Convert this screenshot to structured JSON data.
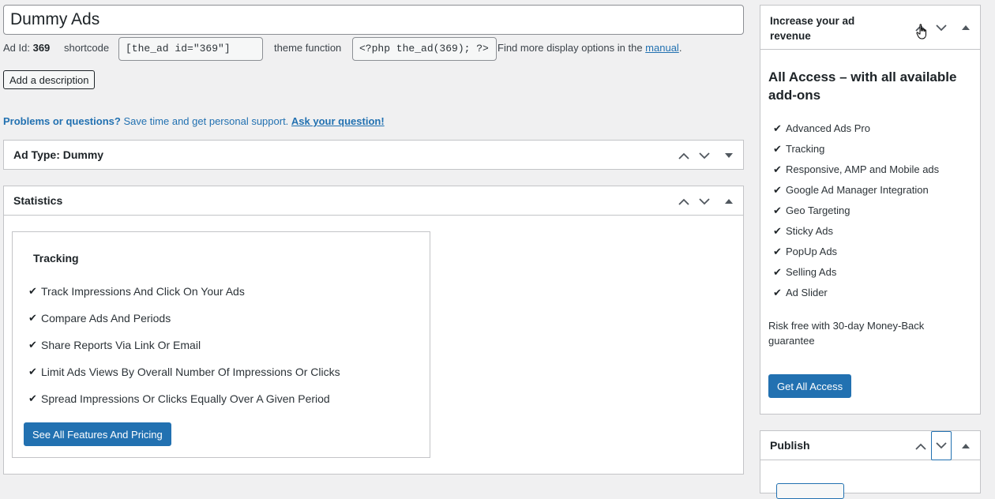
{
  "title_input": {
    "value": "Dummy Ads"
  },
  "meta": {
    "ad_id_label": "Ad Id:",
    "ad_id_value": "369",
    "shortcode_label": "shortcode",
    "shortcode_value": "[the_ad id=\"369\"]",
    "theme_function_label": "theme function",
    "theme_function_value": "<?php the_ad(369); ?>",
    "more_options_text": "Find more display options in the",
    "manual_link": "manual",
    "trailing_period": "."
  },
  "add_description_label": "Add a description",
  "support": {
    "question": "Problems or questions?",
    "text": "Save time and get personal support.",
    "link": "Ask your question!"
  },
  "ad_type_box": {
    "title": "Ad Type: Dummy"
  },
  "statistics_box": {
    "title": "Statistics",
    "card_title": "Tracking",
    "features": [
      "Track Impressions And Click On Your Ads",
      "Compare Ads And Periods",
      "Share Reports Via Link Or Email",
      "Limit Ads Views By Overall Number Of Impressions Or Clicks",
      "Spread Impressions Or Clicks Equally Over A Given Period"
    ],
    "button_label": "See All Features And Pricing"
  },
  "revenue_box": {
    "title": "Increase your ad revenue",
    "heading": "All Access – with all available add-ons",
    "items": [
      "Advanced Ads Pro",
      "Tracking",
      "Responsive, AMP and Mobile ads",
      "Google Ad Manager Integration",
      "Geo Targeting",
      "Sticky Ads",
      "PopUp Ads",
      "Selling Ads",
      "Ad Slider"
    ],
    "note": "Risk free with 30-day Money-Back guarantee",
    "button_label": "Get All Access"
  },
  "publish_box": {
    "title": "Publish"
  },
  "check_glyph": "✔",
  "colors": {
    "accent": "#2271b1",
    "background": "#f0f0f1",
    "border": "#c3c4c7"
  }
}
